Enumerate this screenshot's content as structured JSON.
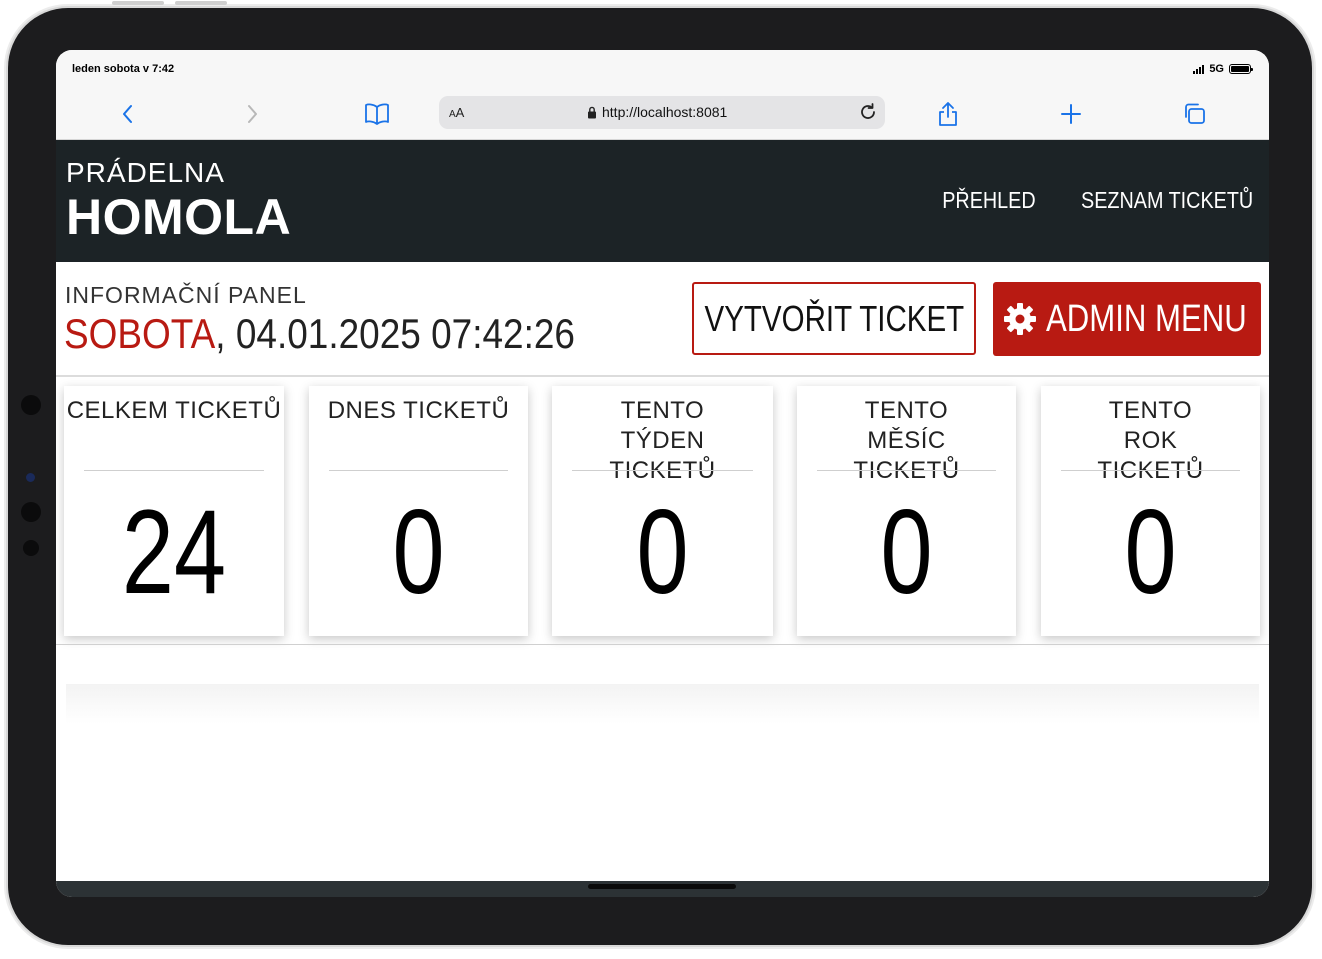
{
  "status_bar": {
    "time": "leden sobota v 7:42",
    "network": "5G"
  },
  "browser": {
    "text_size_label_small": "A",
    "text_size_label_large": "A",
    "url": "http://localhost:8081",
    "accent_color": "#1a73e8"
  },
  "header": {
    "brand_top": "PRÁDELNA",
    "brand_main": "HOMOLA",
    "nav": [
      "PŘEHLED",
      "SEZNAM TICKETŮ"
    ]
  },
  "info": {
    "label": "INFORMAČNÍ PANEL",
    "day": "SOBOTA",
    "datetime": ", 04.01.2025 07:42:26",
    "create_button": "VYTVOŘIT TICKET",
    "admin_button": "ADMIN MENU",
    "accent_color": "#b81a12"
  },
  "cards": [
    {
      "title": "CELKEM TICKETŮ",
      "value": "24"
    },
    {
      "title": "DNES TICKETŮ",
      "value": "0"
    },
    {
      "title": "TENTO TÝDEN TICKETŮ",
      "value": "0"
    },
    {
      "title": "TENTO MĚSÍC TICKETŮ",
      "value": "0"
    },
    {
      "title": "TENTO ROK TICKETŮ",
      "value": "0"
    }
  ]
}
